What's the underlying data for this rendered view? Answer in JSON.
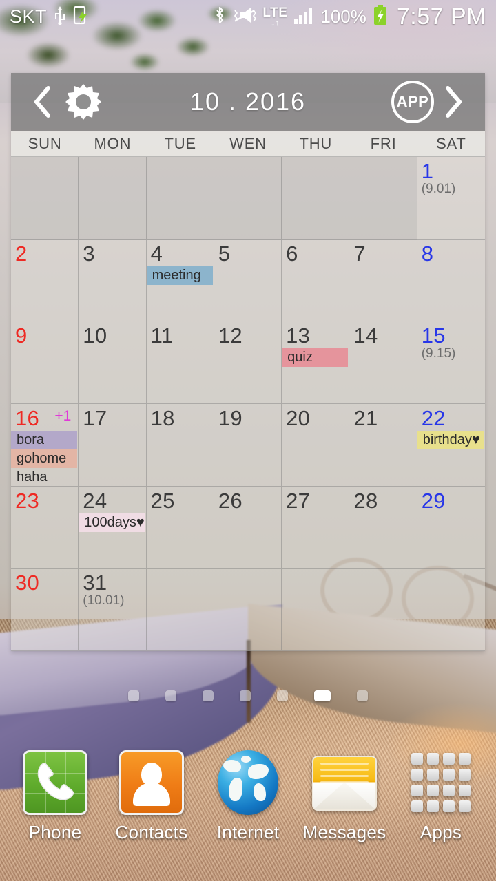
{
  "statusbar": {
    "carrier": "SKT",
    "icons_left": [
      "usb-icon",
      "device-charging-icon"
    ],
    "icons_right": [
      "bluetooth-icon",
      "vibrate-mute-icon",
      "lte-icon",
      "signal-bars-icon"
    ],
    "lte_label": "LTE",
    "battery_percent": "100%",
    "battery_state": "charging",
    "clock": "7:57 PM"
  },
  "calendar": {
    "title": "10 . 2016",
    "prev_label": "‹",
    "next_label": "›",
    "gear_label": "settings",
    "app_label": "APP",
    "dow": [
      "SUN",
      "MON",
      "TUE",
      "WEN",
      "THU",
      "FRI",
      "SAT"
    ],
    "colors": {
      "sunday": "#ee2a24",
      "saturday": "#2736e8",
      "weekday": "#3b3b3b",
      "plus_badge": "#e03ad8",
      "event_meeting": "#8cb4cc",
      "event_quiz": "#e5949c",
      "event_birthday": "#e8e08c",
      "event_bora": "#b3a8c9",
      "event_gohome": "#e3b5a5",
      "event_100days": "#f0dce4",
      "header_bg": "#767676"
    },
    "weeks": [
      [
        {
          "day": "",
          "trailing": true
        },
        {
          "day": "",
          "trailing": true
        },
        {
          "day": "",
          "trailing": true
        },
        {
          "day": "",
          "trailing": true
        },
        {
          "day": "",
          "trailing": true
        },
        {
          "day": "",
          "trailing": true
        },
        {
          "day": "1",
          "type": "sat",
          "lunar": "(9.01)"
        }
      ],
      [
        {
          "day": "2",
          "type": "sun"
        },
        {
          "day": "3",
          "type": "wd"
        },
        {
          "day": "4",
          "type": "wd",
          "events": [
            {
              "text": "meeting",
              "bg": "#8cb4cc"
            }
          ]
        },
        {
          "day": "5",
          "type": "wd"
        },
        {
          "day": "6",
          "type": "wd"
        },
        {
          "day": "7",
          "type": "wd"
        },
        {
          "day": "8",
          "type": "sat"
        }
      ],
      [
        {
          "day": "9",
          "type": "sun"
        },
        {
          "day": "10",
          "type": "wd"
        },
        {
          "day": "11",
          "type": "wd"
        },
        {
          "day": "12",
          "type": "wd"
        },
        {
          "day": "13",
          "type": "wd",
          "events": [
            {
              "text": "quiz",
              "bg": "#e5949c"
            }
          ]
        },
        {
          "day": "14",
          "type": "wd"
        },
        {
          "day": "15",
          "type": "sat",
          "lunar": "(9.15)"
        }
      ],
      [
        {
          "day": "16",
          "type": "sun",
          "badge": "+1",
          "events": [
            {
              "text": "bora",
              "bg": "#b3a8c9"
            },
            {
              "text": "gohome",
              "bg": "#e3b5a5"
            },
            {
              "text": "haha",
              "bg": "transparent"
            }
          ]
        },
        {
          "day": "17",
          "type": "wd"
        },
        {
          "day": "18",
          "type": "wd"
        },
        {
          "day": "19",
          "type": "wd"
        },
        {
          "day": "20",
          "type": "wd"
        },
        {
          "day": "21",
          "type": "wd"
        },
        {
          "day": "22",
          "type": "sat",
          "events": [
            {
              "text": "birthday♥",
              "bg": "#e8e08c"
            }
          ]
        }
      ],
      [
        {
          "day": "23",
          "type": "sun"
        },
        {
          "day": "24",
          "type": "wd",
          "events": [
            {
              "text": "100days♥",
              "bg": "#f0dce4"
            }
          ]
        },
        {
          "day": "25",
          "type": "wd"
        },
        {
          "day": "26",
          "type": "wd"
        },
        {
          "day": "27",
          "type": "wd"
        },
        {
          "day": "28",
          "type": "wd"
        },
        {
          "day": "29",
          "type": "sat"
        }
      ],
      [
        {
          "day": "30",
          "type": "sun"
        },
        {
          "day": "31",
          "type": "wd",
          "lunar": "(10.01)"
        },
        {
          "day": "",
          "trailing": false
        },
        {
          "day": "",
          "trailing": false
        },
        {
          "day": "",
          "trailing": false
        },
        {
          "day": "",
          "trailing": false
        },
        {
          "day": "",
          "trailing": false
        }
      ]
    ]
  },
  "pager": {
    "total": 7,
    "active_index": 5
  },
  "dock": [
    {
      "label": "Phone",
      "icon": "phone-icon"
    },
    {
      "label": "Contacts",
      "icon": "contacts-icon"
    },
    {
      "label": "Internet",
      "icon": "globe-icon"
    },
    {
      "label": "Messages",
      "icon": "envelope-icon"
    },
    {
      "label": "Apps",
      "icon": "apps-grid-icon"
    }
  ]
}
